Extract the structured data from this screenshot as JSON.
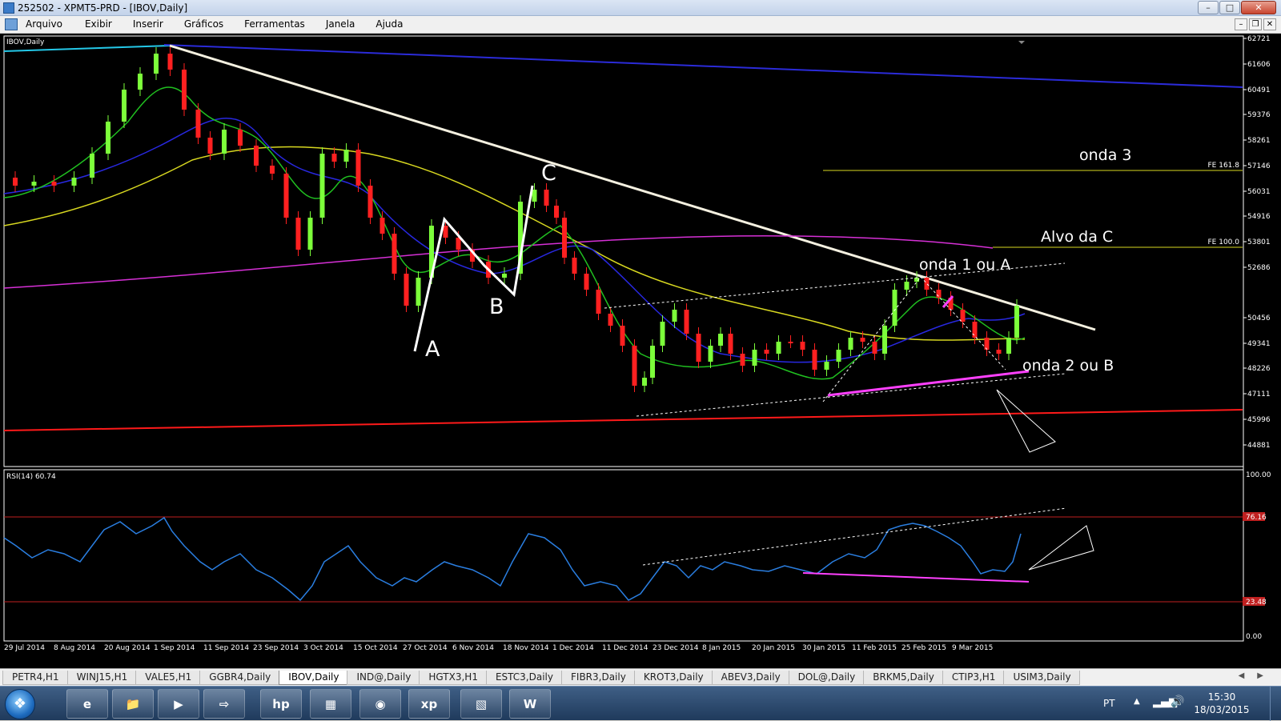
{
  "window": {
    "title": "252502 - XPMT5-PRD - [IBOV,Daily]",
    "min_icon": "minimize-icon",
    "max_icon": "maximize-icon",
    "close_icon": "close-icon"
  },
  "menu": [
    "Arquivo",
    "Exibir",
    "Inserir",
    "Gráficos",
    "Ferramentas",
    "Janela",
    "Ajuda"
  ],
  "chart": {
    "symbol_label": "IBOV,Daily",
    "price_ticks": [
      "62721",
      "61606",
      "60491",
      "59376",
      "58261",
      "57146",
      "56031",
      "54916",
      "53801",
      "52686",
      "50456",
      "49341",
      "48226",
      "47111",
      "45996",
      "44881"
    ],
    "fe_labels": [
      "FE 161.8",
      "FE 100.0"
    ],
    "annotations": [
      "onda 3",
      "Alvo da C",
      "onda 1 ou A",
      "onda 2 ou B",
      "A",
      "B",
      "C"
    ],
    "rsi_label": "RSI(14) 60.74",
    "rsi_ticks": [
      "100.00",
      "76.16",
      "23.48",
      "0.00"
    ],
    "date_ticks": [
      "29 Jul 2014",
      "8 Aug 2014",
      "20 Aug 2014",
      "1 Sep 2014",
      "11 Sep 2014",
      "23 Sep 2014",
      "3 Oct 2014",
      "15 Oct 2014",
      "27 Oct 2014",
      "6 Nov 2014",
      "18 Nov 2014",
      "1 Dec 2014",
      "11 Dec 2014",
      "23 Dec 2014",
      "8 Jan 2015",
      "20 Jan 2015",
      "30 Jan 2015",
      "11 Feb 2015",
      "25 Feb 2015",
      "9 Mar 2015"
    ]
  },
  "tabs": [
    "PETR4,H1",
    "WINJ15,H1",
    "VALE5,H1",
    "GGBR4,Daily",
    "IBOV,Daily",
    "IND@,Daily",
    "HGTX3,H1",
    "ESTC3,Daily",
    "FIBR3,Daily",
    "KROT3,Daily",
    "ABEV3,Daily",
    "DOL@,Daily",
    "BRKM5,Daily",
    "CTIP3,H1",
    "USIM3,Daily"
  ],
  "active_tab": "IBOV,Daily",
  "taskbar": {
    "apps": [
      "ie-icon",
      "folder-icon",
      "media-icon",
      "network-icon",
      "hp-icon",
      "archive-icon",
      "chrome-icon",
      "xp-icon",
      "chart-app-icon",
      "word-icon"
    ],
    "xp_label": "xp",
    "lang": "PT",
    "time": "15:30",
    "date": "18/03/2015"
  }
}
